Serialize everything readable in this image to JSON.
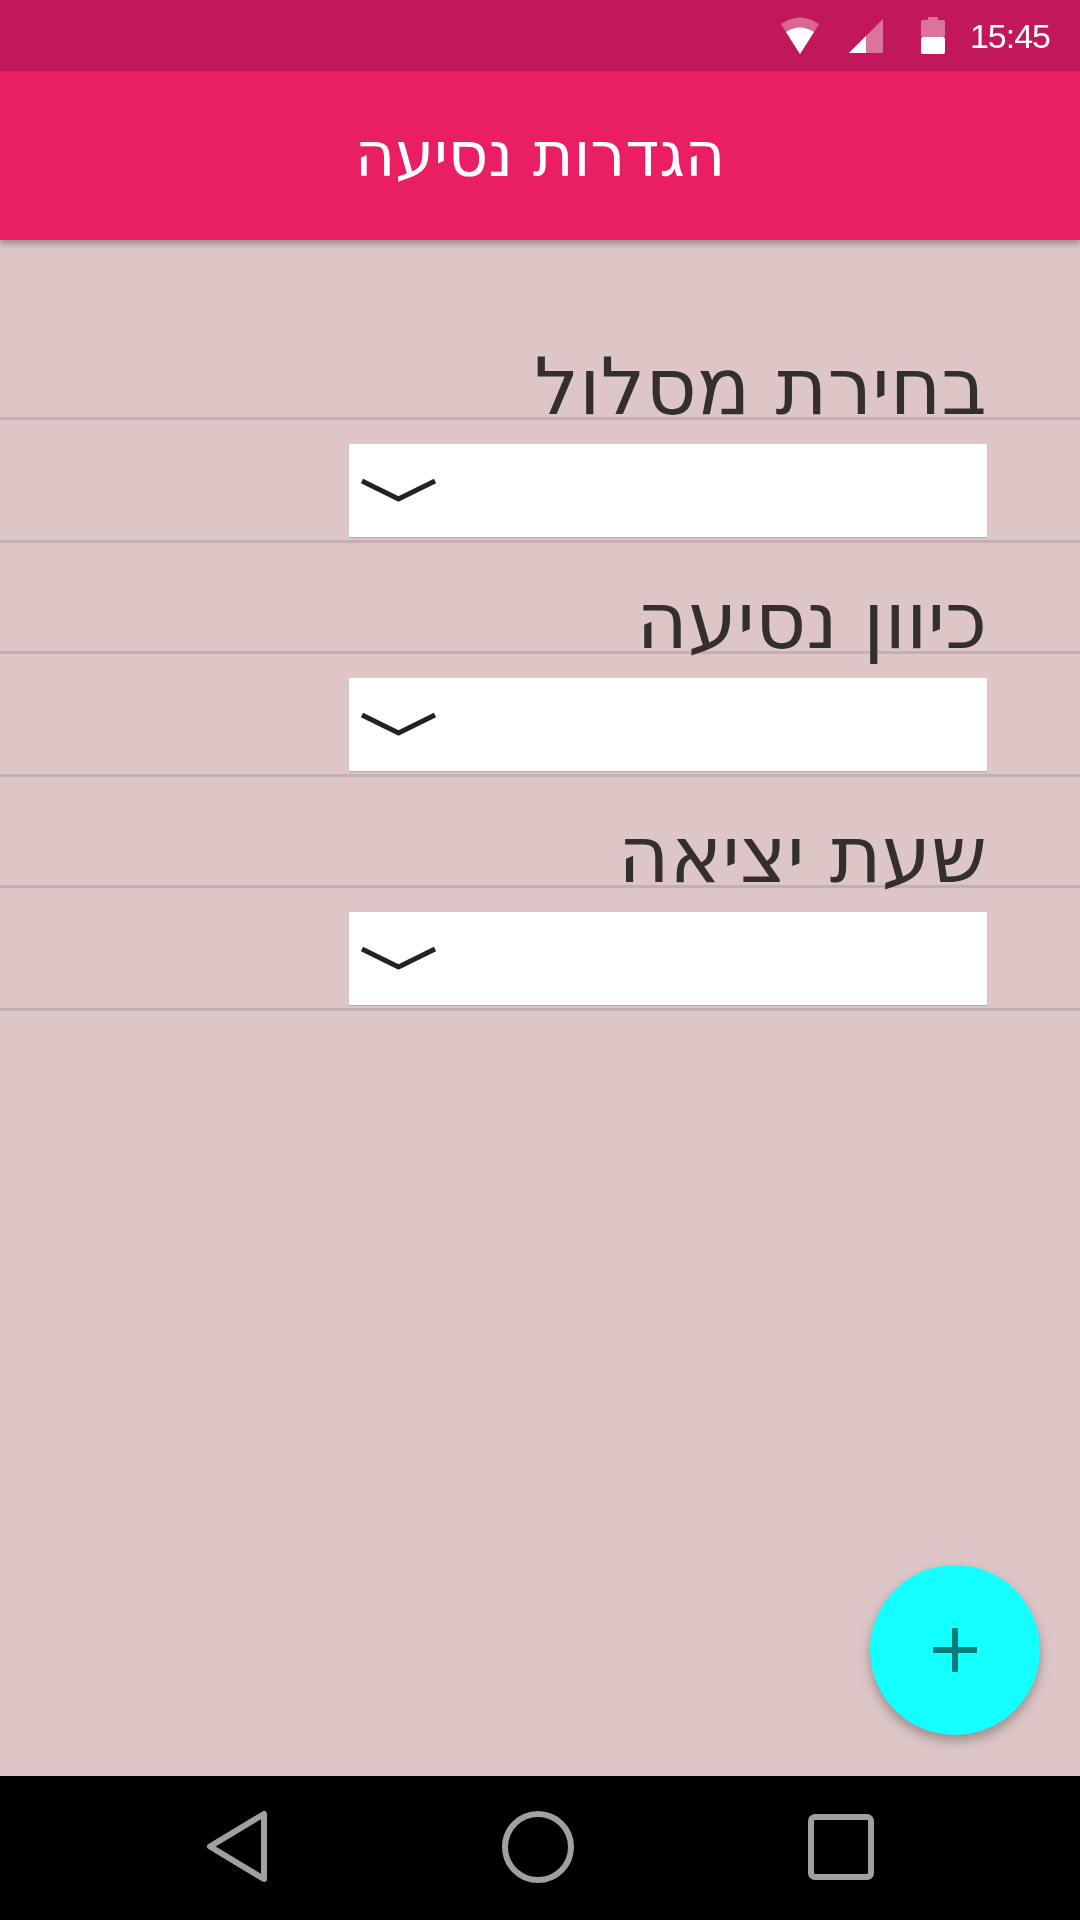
{
  "status_bar": {
    "time": "15:45"
  },
  "app_bar": {
    "title": "הגדרות נסיעה"
  },
  "fields": [
    {
      "label": "בחירת מסלול"
    },
    {
      "label": "כיוון נסיעה"
    },
    {
      "label": "שעת יציאה"
    }
  ]
}
